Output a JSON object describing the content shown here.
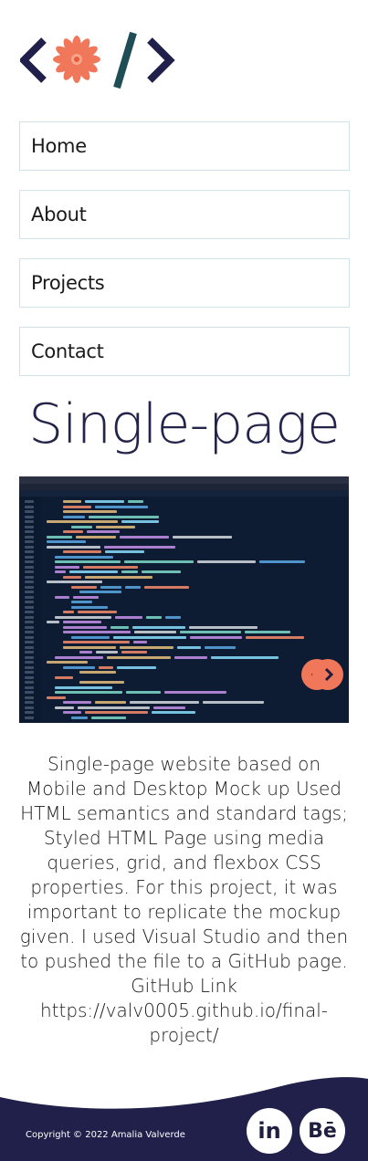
{
  "colors": {
    "navy": "#20204a",
    "accent": "#f0775a",
    "teal": "#1f4d56",
    "nav_border": "#cfe3e8",
    "code_bg": "#0d1b33"
  },
  "nav": {
    "items": [
      {
        "label": "Home"
      },
      {
        "label": "About"
      },
      {
        "label": "Projects"
      },
      {
        "label": "Contact"
      }
    ]
  },
  "project": {
    "title": "Single-page",
    "description": "Single-page website based on Mobile and Desktop Mock up Used HTML semantics and standard tags; Styled HTML Page using media queries, grid, and flexbox CSS properties. For this project, it was important to replicate the mockup given. I used Visual Studio and then to pushed the file to a GitHub page. GitHub Link https://valv0005.github.io/final-project/",
    "slider": {
      "prev_icon": "chevron-left-icon",
      "next_icon": "chevron-right-icon"
    }
  },
  "footer": {
    "copyright": "Copyright © 2022 Amalia Valverde",
    "social": [
      {
        "label": "in",
        "icon": "linkedin-icon"
      },
      {
        "label": "Bē",
        "icon": "behance-icon"
      }
    ]
  }
}
